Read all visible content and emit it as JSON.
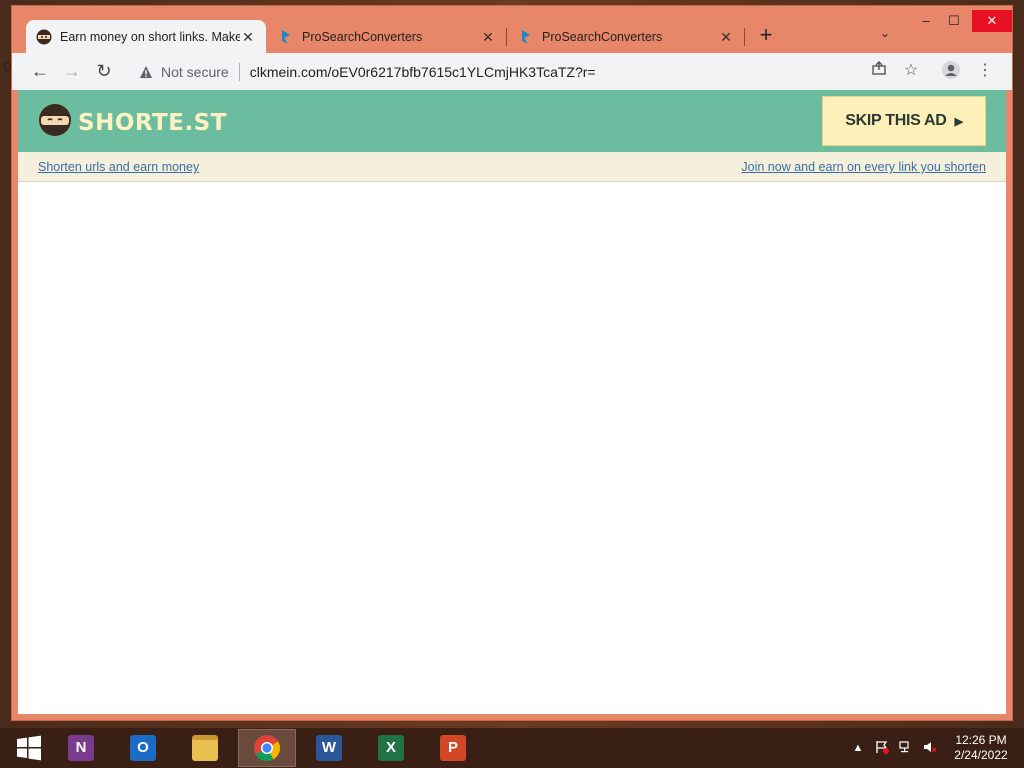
{
  "desktop": {
    "edge_label": "D"
  },
  "browser": {
    "tabs": [
      {
        "title": "Earn money on short links. Make",
        "active": true,
        "favicon": "ninja-favicon"
      },
      {
        "title": "ProSearchConverters",
        "active": false,
        "favicon": "prosearch-favicon"
      },
      {
        "title": "ProSearchConverters",
        "active": false,
        "favicon": "prosearch-favicon"
      }
    ],
    "new_tab_label": "+",
    "tab_search_label": "⌄",
    "window_controls": {
      "minimize": "–",
      "maximize": "☐",
      "close": "✕"
    },
    "toolbar": {
      "back": "←",
      "forward": "→",
      "reload": "↻",
      "security_label": "Not secure",
      "url": "clkmein.com/oEV0r6217bfb7615c1YLCmjHK3TcaTZ?r=",
      "share_icon": "share-icon",
      "bookmark_icon": "star-icon",
      "profile_icon": "profile-icon",
      "menu_icon": "kebab-menu-icon"
    }
  },
  "site": {
    "logo_text": "SHORTE.ST",
    "skip_button": "SKIP THIS AD",
    "link_left": "Shorten urls and earn money",
    "link_right": "Join now and earn on every link you shorten",
    "colors": {
      "header": "#6cbca0",
      "logo_text": "#fdf3c2",
      "skip_bg": "#fdf0b8",
      "subbar": "#f4f0dc",
      "link": "#3a6ea8"
    }
  },
  "taskbar": {
    "apps": [
      {
        "name": "OneNote",
        "letter": "N",
        "color": "#7a3a8e"
      },
      {
        "name": "Outlook",
        "letter": "O",
        "color": "#1a6cc4"
      },
      {
        "name": "File Explorer",
        "letter": "",
        "color": "#e8c050"
      },
      {
        "name": "Chrome",
        "letter": "",
        "color": "#ffffff",
        "active": true
      },
      {
        "name": "Word",
        "letter": "W",
        "color": "#2b579a"
      },
      {
        "name": "Excel",
        "letter": "X",
        "color": "#217346"
      },
      {
        "name": "PowerPoint",
        "letter": "P",
        "color": "#d24726"
      }
    ],
    "time": "12:26 PM",
    "date": "2/24/2022"
  }
}
